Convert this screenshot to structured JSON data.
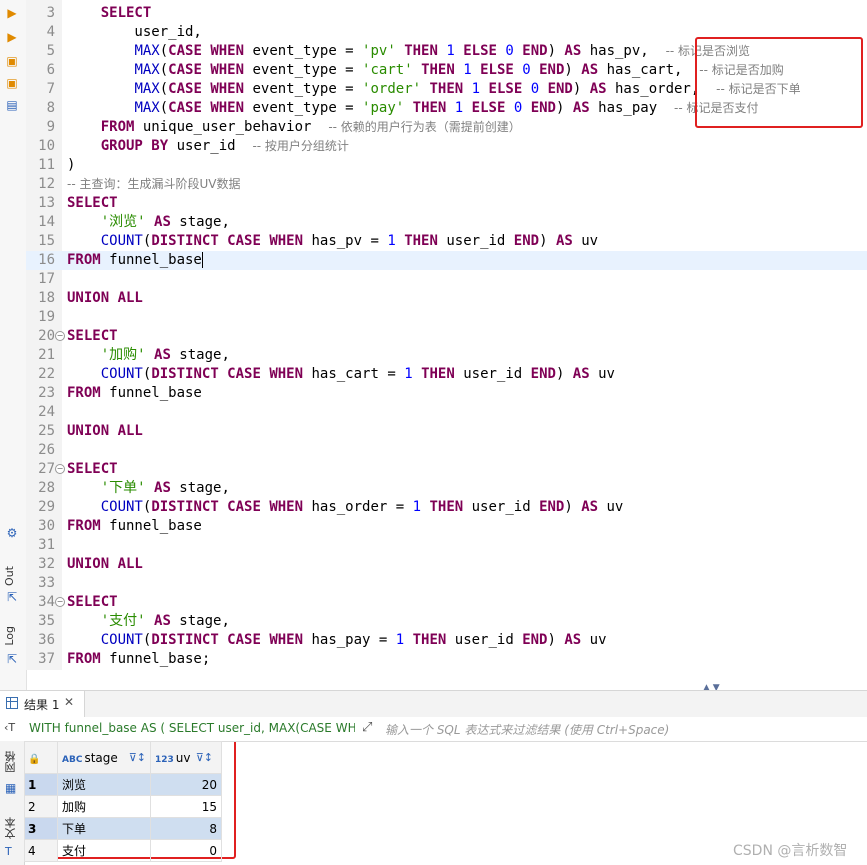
{
  "editor": {
    "lines": [
      {
        "n": "3",
        "html": "    <span class='kw'>SELECT</span>"
      },
      {
        "n": "4",
        "html": "        user_id,"
      },
      {
        "n": "5",
        "html": "        <span class='fn'>MAX</span>(<span class='kw'>CASE WHEN</span> event_type = <span class='str'>'pv'</span> <span class='kw'>THEN</span> <span class='num'>1</span> <span class='kw'>ELSE</span> <span class='num'>0</span> <span class='kw'>END</span>) <span class='kw'>AS</span> has_pv,  <span class='cm'>-- 标记是否浏览</span>"
      },
      {
        "n": "6",
        "html": "        <span class='fn'>MAX</span>(<span class='kw'>CASE WHEN</span> event_type = <span class='str'>'cart'</span> <span class='kw'>THEN</span> <span class='num'>1</span> <span class='kw'>ELSE</span> <span class='num'>0</span> <span class='kw'>END</span>) <span class='kw'>AS</span> has_cart,  <span class='cm'>-- 标记是否加购</span>"
      },
      {
        "n": "7",
        "html": "        <span class='fn'>MAX</span>(<span class='kw'>CASE WHEN</span> event_type = <span class='str'>'order'</span> <span class='kw'>THEN</span> <span class='num'>1</span> <span class='kw'>ELSE</span> <span class='num'>0</span> <span class='kw'>END</span>) <span class='kw'>AS</span> has_order,  <span class='cm'>-- 标记是否下单</span>"
      },
      {
        "n": "8",
        "html": "        <span class='fn'>MAX</span>(<span class='kw'>CASE WHEN</span> event_type = <span class='str'>'pay'</span> <span class='kw'>THEN</span> <span class='num'>1</span> <span class='kw'>ELSE</span> <span class='num'>0</span> <span class='kw'>END</span>) <span class='kw'>AS</span> has_pay  <span class='cm'>-- 标记是否支付</span>"
      },
      {
        "n": "9",
        "html": "    <span class='kw'>FROM</span> unique_user_behavior  <span class='cm'>-- 依赖的用户行为表（需提前创建）</span>"
      },
      {
        "n": "10",
        "html": "    <span class='kw'>GROUP BY</span> user_id  <span class='cm'>-- 按用户分组统计</span>"
      },
      {
        "n": "11",
        "html": ")"
      },
      {
        "n": "12",
        "html": "<span class='cm'>-- 主查询：生成漏斗阶段UV数据</span>"
      },
      {
        "n": "13",
        "html": "<span class='kw'>SELECT</span>"
      },
      {
        "n": "14",
        "html": "    <span class='str'>'浏览'</span> <span class='kw'>AS</span> stage,"
      },
      {
        "n": "15",
        "html": "    <span class='fn'>COUNT</span>(<span class='kw'>DISTINCT CASE WHEN</span> has_pv = <span class='num'>1</span> <span class='kw'>THEN</span> user_id <span class='kw'>END</span>) <span class='kw'>AS</span> uv"
      },
      {
        "n": "16",
        "html": "<span class='kw'>FROM</span> funnel_base<span class='caret'></span>"
      },
      {
        "n": "17",
        "html": ""
      },
      {
        "n": "18",
        "html": "<span class='kw'>UNION ALL</span>"
      },
      {
        "n": "19",
        "html": ""
      },
      {
        "n": "20",
        "html": "<span class='kw'>SELECT</span>"
      },
      {
        "n": "21",
        "html": "    <span class='str'>'加购'</span> <span class='kw'>AS</span> stage,"
      },
      {
        "n": "22",
        "html": "    <span class='fn'>COUNT</span>(<span class='kw'>DISTINCT CASE WHEN</span> has_cart = <span class='num'>1</span> <span class='kw'>THEN</span> user_id <span class='kw'>END</span>) <span class='kw'>AS</span> uv"
      },
      {
        "n": "23",
        "html": "<span class='kw'>FROM</span> funnel_base"
      },
      {
        "n": "24",
        "html": ""
      },
      {
        "n": "25",
        "html": "<span class='kw'>UNION ALL</span>"
      },
      {
        "n": "26",
        "html": ""
      },
      {
        "n": "27",
        "html": "<span class='kw'>SELECT</span>"
      },
      {
        "n": "28",
        "html": "    <span class='str'>'下单'</span> <span class='kw'>AS</span> stage,"
      },
      {
        "n": "29",
        "html": "    <span class='fn'>COUNT</span>(<span class='kw'>DISTINCT CASE WHEN</span> has_order = <span class='num'>1</span> <span class='kw'>THEN</span> user_id <span class='kw'>END</span>) <span class='kw'>AS</span> uv"
      },
      {
        "n": "30",
        "html": "<span class='kw'>FROM</span> funnel_base"
      },
      {
        "n": "31",
        "html": ""
      },
      {
        "n": "32",
        "html": "<span class='kw'>UNION ALL</span>"
      },
      {
        "n": "33",
        "html": ""
      },
      {
        "n": "34",
        "html": "<span class='kw'>SELECT</span>"
      },
      {
        "n": "35",
        "html": "    <span class='str'>'支付'</span> <span class='kw'>AS</span> stage,"
      },
      {
        "n": "36",
        "html": "    <span class='fn'>COUNT</span>(<span class='kw'>DISTINCT CASE WHEN</span> has_pay = <span class='num'>1</span> <span class='kw'>THEN</span> user_id <span class='kw'>END</span>) <span class='kw'>AS</span> uv"
      },
      {
        "n": "37",
        "html": "<span class='kw'>FROM</span> funnel_base;"
      }
    ],
    "current_line": "16",
    "fold_lines": [
      "20",
      "27",
      "34"
    ]
  },
  "left_toolbar": {
    "out_label": "Out",
    "log_label": "Log"
  },
  "results": {
    "tab_label": "结果 1",
    "close_glyph": "✕",
    "filter_query": "WITH funnel_base AS ( SELECT user_id, MAX(CASE WHE",
    "filter_placeholder": "输入一个 SQL 表达式来过滤结果 (使用 Ctrl+Space)",
    "side_tabs": [
      "网格",
      "文本"
    ],
    "columns": [
      {
        "type": "ABC",
        "name": "stage"
      },
      {
        "type": "123",
        "name": "uv"
      }
    ],
    "rows": [
      {
        "num": "1",
        "stage": "浏览",
        "uv": "20"
      },
      {
        "num": "2",
        "stage": "加购",
        "uv": "15"
      },
      {
        "num": "3",
        "stage": "下单",
        "uv": "8"
      },
      {
        "num": "4",
        "stage": "支付",
        "uv": "0"
      }
    ]
  },
  "watermark": "CSDN @言析数智",
  "colors": {
    "keyword": "#7f0055",
    "string": "#2a8c00",
    "number": "#0000ff",
    "highlight_box": "#e02020"
  }
}
